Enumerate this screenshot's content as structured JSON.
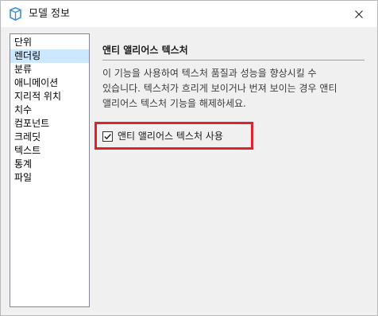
{
  "window": {
    "title": "모델 정보"
  },
  "sidebar": {
    "items": [
      {
        "label": "단위",
        "selected": false
      },
      {
        "label": "렌더링",
        "selected": true
      },
      {
        "label": "분류",
        "selected": false
      },
      {
        "label": "애니메이션",
        "selected": false
      },
      {
        "label": "지리적 위치",
        "selected": false
      },
      {
        "label": "치수",
        "selected": false
      },
      {
        "label": "컴포넌트",
        "selected": false
      },
      {
        "label": "크레딧",
        "selected": false
      },
      {
        "label": "텍스트",
        "selected": false
      },
      {
        "label": "통계",
        "selected": false
      },
      {
        "label": "파일",
        "selected": false
      }
    ]
  },
  "main": {
    "section_title": "앤티 앨리어스 텍스처",
    "description_lines": [
      "이 기능을 사용하여 텍스처 품질과 성능을 향상시킬 수",
      "있습니다. 텍스처가 흐리게 보이거나 번져 보이는 경우 앤티",
      "앨리어스 텍스처 기능을 해제하세요."
    ],
    "checkbox": {
      "label": "앤티 앨리어스 텍스처 사용",
      "checked": true
    }
  },
  "colors": {
    "highlight": "#e4202b",
    "selection": "#cce8ff",
    "app_icon": "#3a8fd8"
  }
}
